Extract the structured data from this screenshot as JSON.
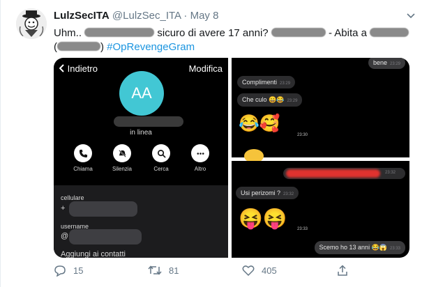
{
  "tweet": {
    "display_name": "LulzSecITA",
    "handle": "@LulzSec_ITA",
    "separator": "·",
    "date": "May 8",
    "text": {
      "p1": "Uhm..",
      "p2": "sicuro di avere 17 anni?",
      "p3": "- Abita a",
      "p4": "(",
      "p5": ")",
      "hashtag": "#OpRevengeGram"
    },
    "replies": "15",
    "retweets": "81",
    "likes": "405"
  },
  "profile_screen": {
    "back_label": "Indietro",
    "edit_label": "Modifica",
    "initials": "AA",
    "status": "in linea",
    "actions": [
      "Chiama",
      "Silenzia",
      "Cerca",
      "Altro"
    ],
    "field1_label": "cellulare",
    "field1_prefix": "+",
    "field2_label": "username",
    "field2_prefix": "@",
    "add_contact": "Aggiungi ai contatti"
  },
  "chat_top": {
    "msg_bene": "bene",
    "msg_bene_time": "23:29",
    "msg_complimenti": "Complimenti",
    "msg_complimenti_time": "23:29",
    "msg_checulo": "Che culo 😄😂",
    "msg_checulo_time": "23:29",
    "emoji_row": "😂🥰",
    "emoji_time": "23:30"
  },
  "chat_bottom": {
    "msg_top_time": "23:32",
    "msg_perizomi": "Usi perizomi ?",
    "msg_perizomi_time": "23:32",
    "emoji_row": "😝😝",
    "emoji_time": "23:33",
    "msg_scemo": "Scemo ho 13 anni 😂😱",
    "msg_scemo_time": "23:33"
  },
  "colors": {
    "accent": "#1b95e0",
    "avatar_teal": "#42c7d4",
    "redaction_red": "#e0322f"
  }
}
